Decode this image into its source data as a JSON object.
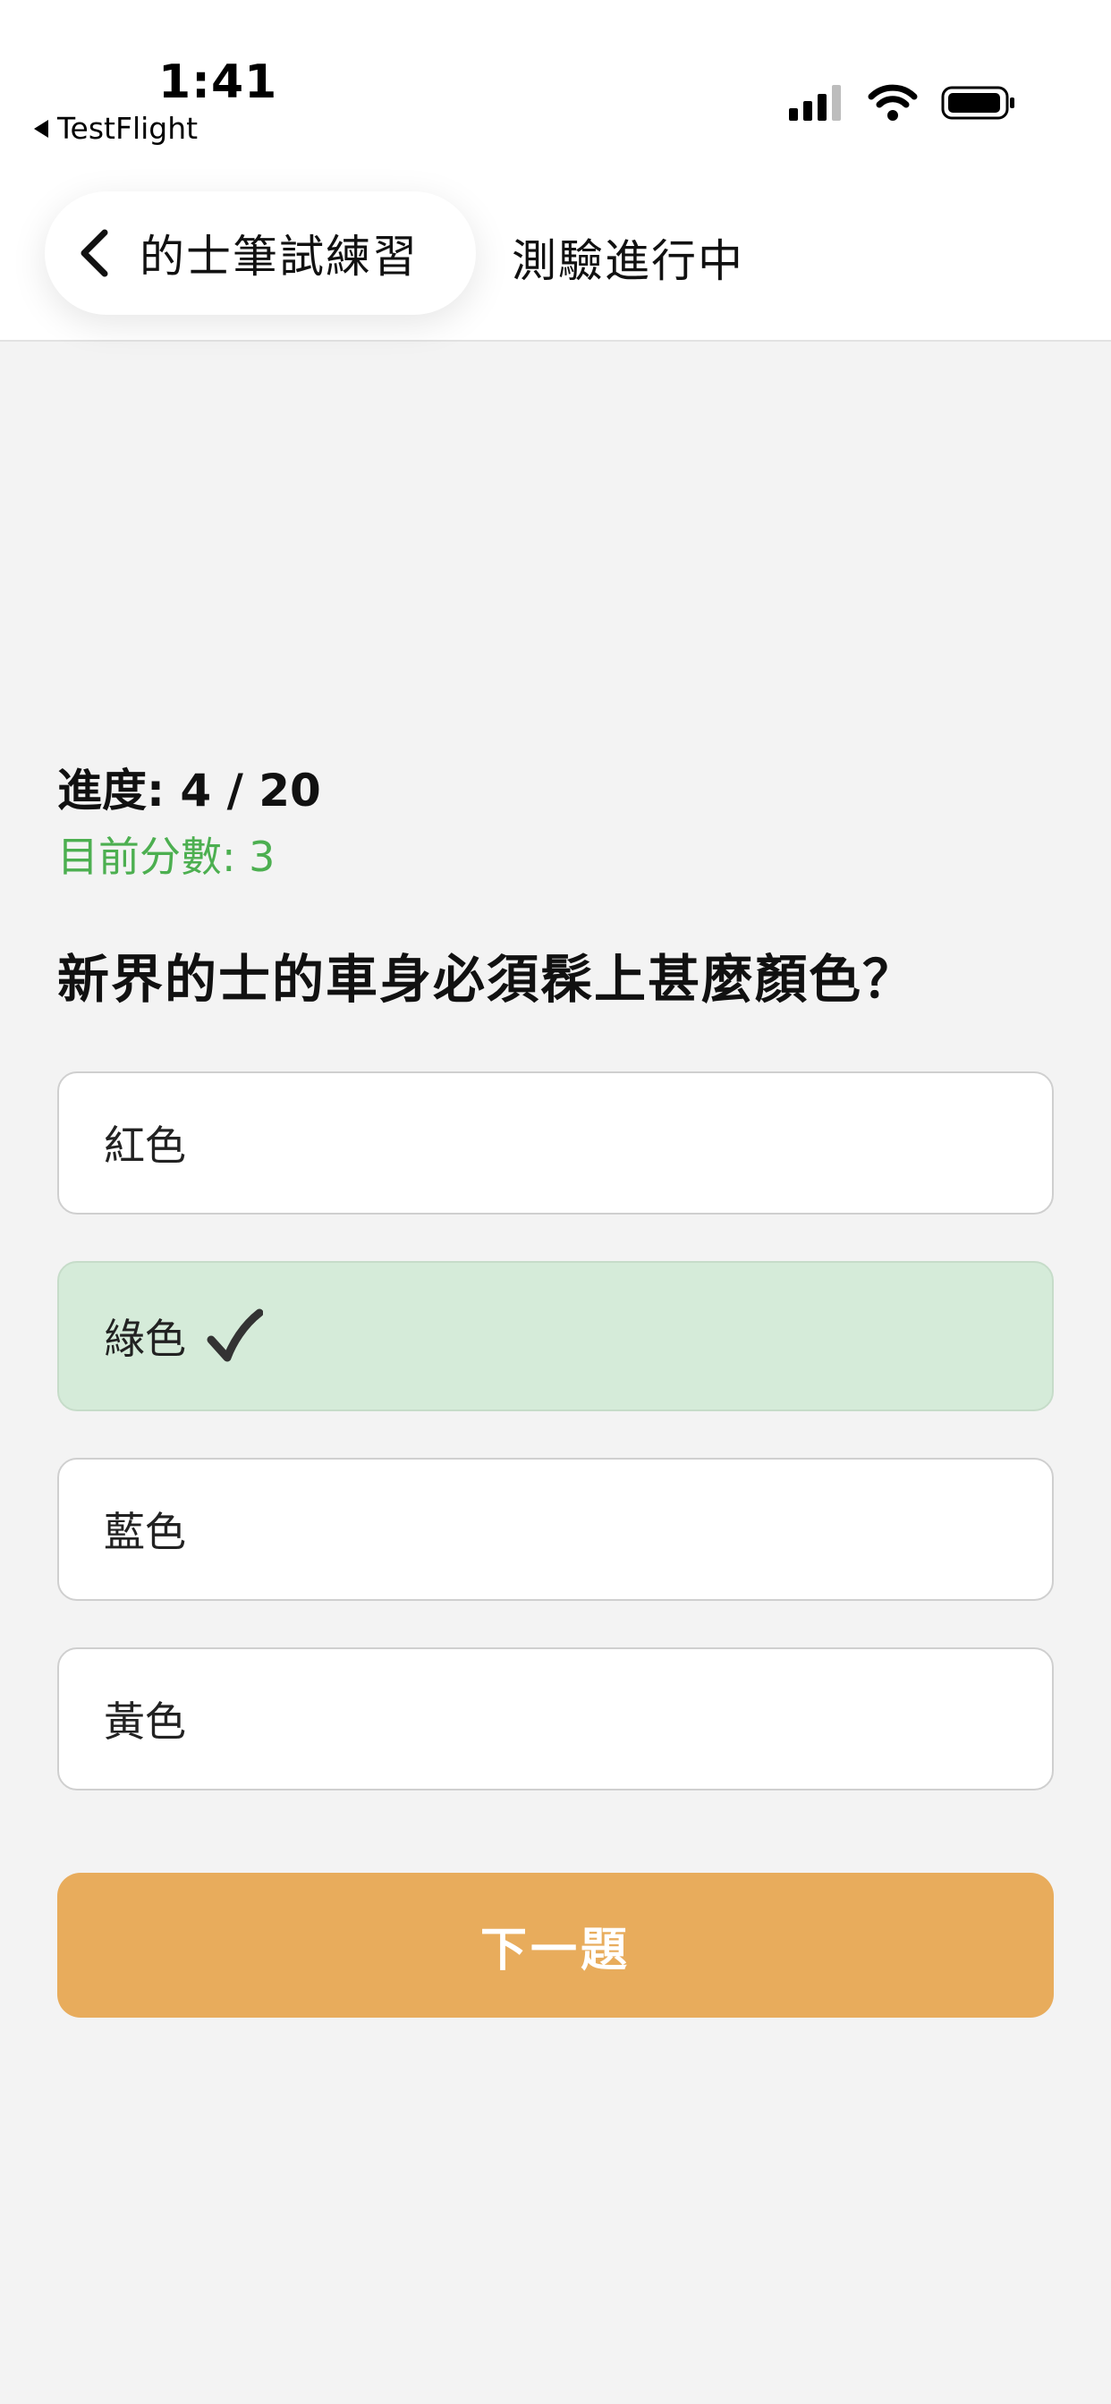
{
  "status_bar": {
    "time": "1:41",
    "back_app": "TestFlight",
    "icons": [
      "signal-icon",
      "wifi-icon",
      "battery-icon"
    ]
  },
  "header": {
    "back_label": "的士筆試練習",
    "title": "測驗進行中",
    "back_icon": "chevron-left-icon"
  },
  "quiz": {
    "progress": "進度: 4 / 20",
    "score": "目前分數: 3",
    "question": "新界的士的車身必須髹上甚麼顏色？",
    "options": [
      {
        "label": "紅色",
        "correct": false
      },
      {
        "label": "綠色",
        "correct": true
      },
      {
        "label": "藍色",
        "correct": false
      },
      {
        "label": "黃色",
        "correct": false
      }
    ],
    "next_label": "下一題"
  },
  "colors": {
    "background": "#f3f3f3",
    "score_green": "#4caf50",
    "correct_bg": "#d5ebd9",
    "next_button": "#e8ac5c"
  }
}
